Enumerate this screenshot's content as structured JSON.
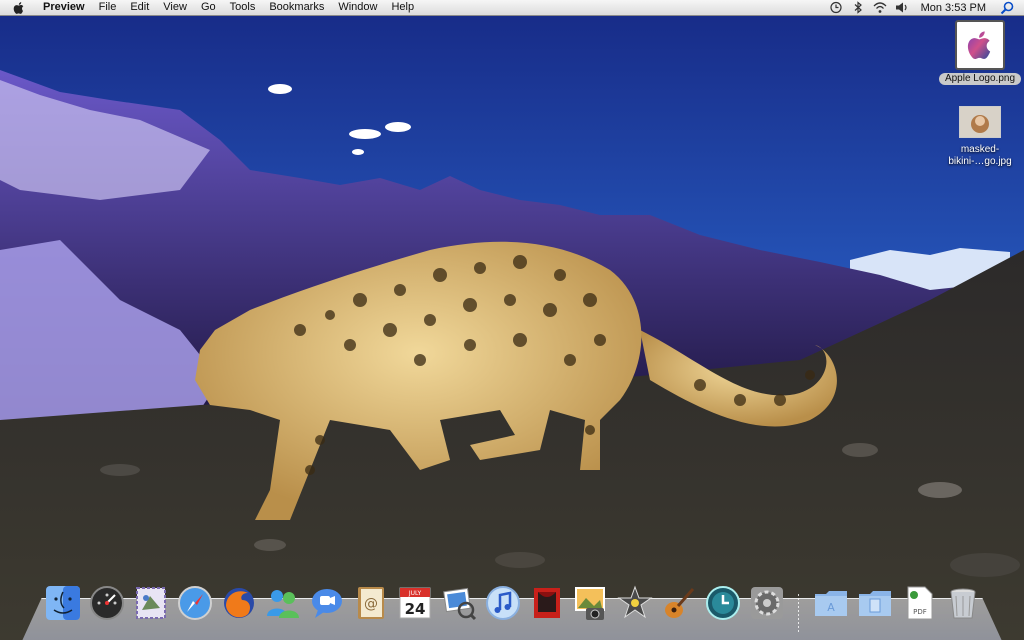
{
  "menubar": {
    "apple_icon": "apple-logo-icon",
    "app_name": "Preview",
    "menus": [
      "File",
      "Edit",
      "View",
      "Go",
      "Tools",
      "Bookmarks",
      "Window",
      "Help"
    ],
    "status_icons": [
      "time-machine-icon",
      "bluetooth-icon",
      "wifi-icon",
      "volume-icon"
    ],
    "clock": "Mon 3:53 PM",
    "spotlight_icon": "spotlight-search-icon"
  },
  "desktop": {
    "files": [
      {
        "label": "Apple Logo.png",
        "icon": "image-file-icon",
        "selected": true
      },
      {
        "label_line1": "masked-",
        "label_line2": "bikini-…go.jpg",
        "icon": "image-file-icon",
        "selected": false
      }
    ]
  },
  "dock": {
    "items": [
      {
        "name": "Finder",
        "icon": "finder-icon"
      },
      {
        "name": "Dashboard",
        "icon": "dashboard-icon"
      },
      {
        "name": "Mail",
        "icon": "mail-icon"
      },
      {
        "name": "Safari",
        "icon": "safari-compass-icon"
      },
      {
        "name": "Firefox",
        "icon": "firefox-icon"
      },
      {
        "name": "iChat",
        "icon": "people-icon"
      },
      {
        "name": "iChat",
        "icon": "speech-bubble-icon"
      },
      {
        "name": "Address Book",
        "icon": "address-book-icon"
      },
      {
        "name": "iCal",
        "icon": "calendar-icon",
        "text_month": "JULY",
        "text_day": "24"
      },
      {
        "name": "Preview",
        "icon": "preview-icon"
      },
      {
        "name": "iTunes",
        "icon": "itunes-icon"
      },
      {
        "name": "Photo Booth",
        "icon": "photo-booth-icon"
      },
      {
        "name": "iPhoto",
        "icon": "iphoto-icon"
      },
      {
        "name": "iMovie",
        "icon": "imovie-star-icon"
      },
      {
        "name": "GarageBand",
        "icon": "guitar-icon"
      },
      {
        "name": "Time Machine",
        "icon": "time-machine-icon"
      },
      {
        "name": "System Preferences",
        "icon": "system-preferences-gear-icon"
      },
      {
        "name": "Applications",
        "icon": "folder-icon"
      },
      {
        "name": "Documents",
        "icon": "folder-icon"
      },
      {
        "name": "PDF",
        "icon": "pdf-file-icon",
        "text": "PDF"
      },
      {
        "name": "Trash",
        "icon": "trash-icon"
      }
    ]
  },
  "colors": {
    "sky_top": "#1a2f8a",
    "sky_bottom": "#2e6fd6",
    "mountain": "#3a2a8a",
    "ground": "#2a2822",
    "leopard": "#d9b46a"
  }
}
